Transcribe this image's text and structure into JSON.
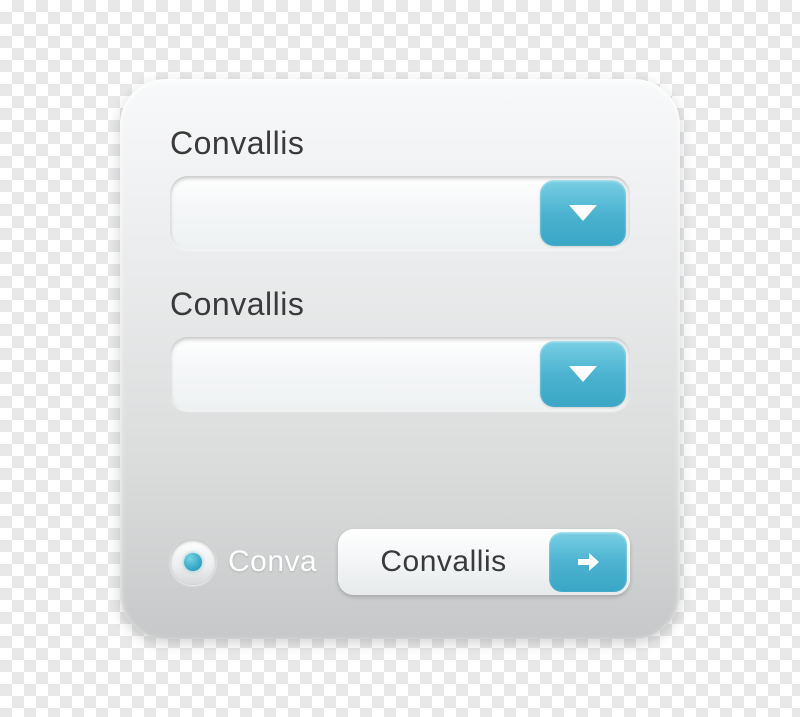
{
  "fields": [
    {
      "label": "Convallis",
      "value": ""
    },
    {
      "label": "Convallis",
      "value": ""
    }
  ],
  "radio": {
    "label": "Conva",
    "checked": true
  },
  "action": {
    "label": "Convallis"
  },
  "colors": {
    "accent": "#4cb3d0"
  }
}
